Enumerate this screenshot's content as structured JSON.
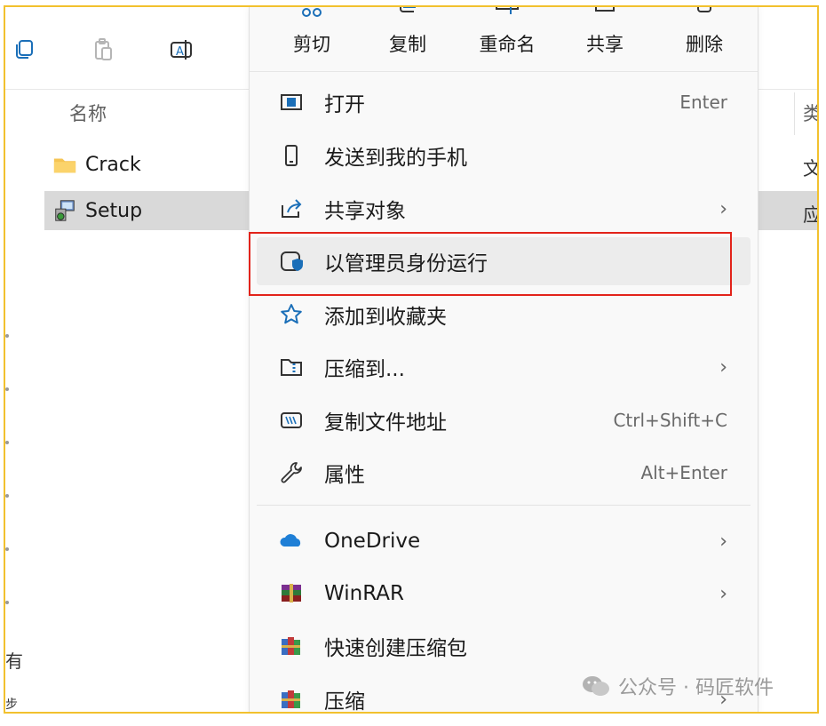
{
  "explorer": {
    "column_name": "名称",
    "column_type_partial": "类",
    "files": [
      {
        "name": "Crack",
        "icon": "folder-icon",
        "type_partial": "文"
      },
      {
        "name": "Setup",
        "icon": "installer-icon",
        "type_partial": "应"
      }
    ],
    "left_edge_chars": [
      "有",
      "步"
    ]
  },
  "context_menu": {
    "actions": [
      {
        "label": "剪切",
        "icon": "cut-icon"
      },
      {
        "label": "复制",
        "icon": "copy-icon"
      },
      {
        "label": "重命名",
        "icon": "rename-icon"
      },
      {
        "label": "共享",
        "icon": "share-icon"
      },
      {
        "label": "删除",
        "icon": "delete-icon"
      }
    ],
    "items": [
      {
        "label": "打开",
        "shortcut": "Enter",
        "icon": "open-window-icon"
      },
      {
        "label": "发送到我的手机",
        "icon": "phone-icon"
      },
      {
        "label": "共享对象",
        "arrow": "›",
        "icon": "share-arrow-icon"
      },
      {
        "label": "以管理员身份运行",
        "icon": "admin-shield-icon"
      },
      {
        "label": "添加到收藏夹",
        "icon": "star-icon"
      },
      {
        "label": "压缩到...",
        "arrow": "›",
        "icon": "zip-folder-icon"
      },
      {
        "label": "复制文件地址",
        "shortcut": "Ctrl+Shift+C",
        "icon": "copy-path-icon"
      },
      {
        "label": "属性",
        "shortcut": "Alt+Enter",
        "icon": "wrench-icon"
      },
      {
        "label": "OneDrive",
        "arrow": "›",
        "icon": "onedrive-icon"
      },
      {
        "label": "WinRAR",
        "arrow": "›",
        "icon": "winrar-icon"
      },
      {
        "label": "快速创建压缩包",
        "icon": "winrar-books-icon"
      },
      {
        "label": "压缩",
        "arrow": "›",
        "icon": "winrar-books-icon"
      }
    ]
  },
  "watermark": "公众号 · 码匠软件",
  "colors": {
    "highlight_border": "#e2231a",
    "frame_border": "#f2c12e",
    "selection": "#d9d9d9"
  }
}
